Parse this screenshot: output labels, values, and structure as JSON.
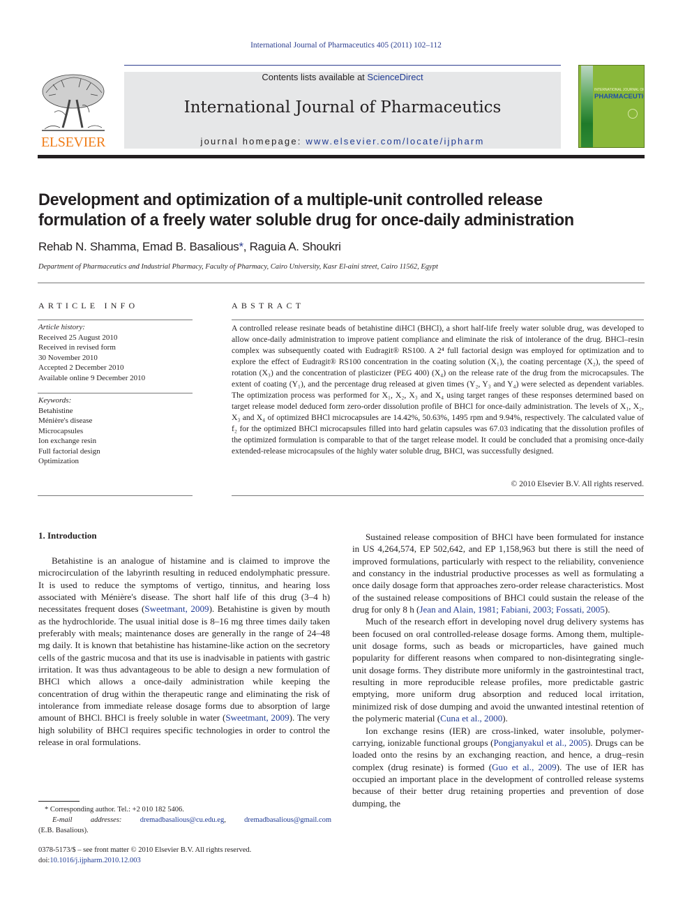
{
  "citation": "International Journal of Pharmaceutics 405 (2011) 102–112",
  "masthead": {
    "contents_prefix": "Contents lists available at ",
    "contents_link": "ScienceDirect",
    "journal_name": "International Journal of Pharmaceutics",
    "homepage_prefix": "journal homepage: ",
    "homepage_url": "www.elsevier.com/locate/ijpharm"
  },
  "publisher_logo": {
    "wordmark": "ELSEVIER",
    "color": "#f07d19"
  },
  "cover": {
    "line1": "INTERNATIONAL JOURNAL OF",
    "line2": "PHARMACEUTICS",
    "color": "#8ab83a"
  },
  "article": {
    "title": "Development and optimization of a multiple-unit controlled release formulation of a freely water soluble drug for once-daily administration",
    "authors": [
      {
        "name": "Rehab N. Shamma",
        "mark": ""
      },
      {
        "name": "Emad B. Basalious",
        "mark": "*"
      },
      {
        "name": "Raguia A. Shoukri",
        "mark": ""
      }
    ],
    "affiliation": "Department of Pharmaceutics and Industrial Pharmacy, Faculty of Pharmacy, Cairo University, Kasr El-aini street, Cairo 11562, Egypt"
  },
  "article_info": {
    "label": "ARTICLE INFO",
    "history_heading": "Article history:",
    "history": [
      "Received 25 August 2010",
      "Received in revised form",
      "30 November 2010",
      "Accepted 2 December 2010",
      "Available online 9 December 2010"
    ],
    "keywords_heading": "Keywords:",
    "keywords": [
      "Betahistine",
      "Ménière's disease",
      "Microcapsules",
      "Ion exchange resin",
      "Full factorial design",
      "Optimization"
    ]
  },
  "abstract": {
    "label": "ABSTRACT",
    "text": "A controlled release resinate beads of betahistine diHCl (BHCl), a short half-life freely water soluble drug, was developed to allow once-daily administration to improve patient compliance and eliminate the risk of intolerance of the drug. BHCl–resin complex was subsequently coated with Eudragit® RS100. A 2⁴ full factorial design was employed for optimization and to explore the effect of Eudragit® RS100 concentration in the coating solution (X₁), the coating percentage (X₂), the speed of rotation (X₃) and the concentration of plasticizer (PEG 400) (X₄) on the release rate of the drug from the microcapsules. The extent of coating (Y₁), and the percentage drug released at given times (Y₂, Y₃ and Y₄) were selected as dependent variables. The optimization process was performed for X₁, X₂, X₃ and X₄ using target ranges of these responses determined based on target release model deduced form zero-order dissolution profile of BHCl for once-daily administration. The levels of X₁, X₂, X₃ and X₄ of optimized BHCl microcapsules are 14.42%, 50.63%, 1495 rpm and 9.94%, respectively. The calculated value of f₂ for the optimized BHCl microcapsules filled into hard gelatin capsules was 67.03 indicating that the dissolution profiles of the optimized formulation is comparable to that of the target release model. It could be concluded that a promising once-daily extended-release microcapsules of the highly water soluble drug, BHCl, was successfully designed.",
    "copyright": "© 2010 Elsevier B.V. All rights reserved."
  },
  "introduction": {
    "heading": "1.  Introduction",
    "left_paragraphs": [
      [
        {
          "t": "Betahistine is an analogue of histamine and is claimed to improve the microcirculation of the labyrinth resulting in reduced endolymphatic pressure. It is used to reduce the symptoms of vertigo, tinnitus, and hearing loss associated with Ménière's disease. The short half life of this drug (3–4 h) necessitates frequent doses ("
        },
        {
          "t": "Sweetmant, 2009",
          "link": true
        },
        {
          "t": "). Betahistine is given by mouth as the hydrochloride. The usual initial dose is 8–16 mg three times daily taken preferably with meals; maintenance doses are generally in the range of 24–48 mg daily. It is known that betahistine has histamine-like action on the secretory cells of the gastric mucosa and that its use is inadvisable in patients with gastric irritation. It was thus advantageous to be able to design a new formulation of BHCl which allows a once-daily administration while keeping the concentration of drug within the therapeutic range and eliminating the risk of intolerance from immediate release dosage forms due to absorption of large amount of BHCl. BHCl is freely soluble in water ("
        },
        {
          "t": "Sweetmant, 2009",
          "link": true
        },
        {
          "t": "). The very high solubility of BHCl requires specific technologies in order to control the release in oral formulations."
        }
      ]
    ],
    "right_paragraphs": [
      [
        {
          "t": "Sustained release composition of BHCl have been formulated for instance in US 4,264,574, EP 502,642, and EP 1,158,963 but there is still the need of improved formulations, particularly with respect to the reliability, convenience and constancy in the industrial productive processes as well as formulating a once daily dosage form that approaches zero-order release characteristics. Most of the sustained release compositions of BHCl could sustain the release of the drug for only 8 h ("
        },
        {
          "t": "Jean and Alain, 1981; Fabiani, 2003; Fossati, 2005",
          "link": true
        },
        {
          "t": ")."
        }
      ],
      [
        {
          "t": "Much of the research effort in developing novel drug delivery systems has been focused on oral controlled-release dosage forms. Among them, multiple-unit dosage forms, such as beads or microparticles, have gained much popularity for different reasons when compared to non-disintegrating single-unit dosage forms. They distribute more uniformly in the gastrointestinal tract, resulting in more reproducible release profiles, more predictable gastric emptying, more uniform drug absorption and reduced local irritation, minimized risk of dose dumping and avoid the unwanted intestinal retention of the polymeric material ("
        },
        {
          "t": "Cuna et al., 2000",
          "link": true
        },
        {
          "t": ")."
        }
      ],
      [
        {
          "t": "Ion exchange resins (IER) are cross-linked, water insoluble, polymer-carrying, ionizable functional groups ("
        },
        {
          "t": "Pongjanyakul et al., 2005",
          "link": true
        },
        {
          "t": "). Drugs can be loaded onto the resins by an exchanging reaction, and hence, a drug–resin complex (drug resinate) is formed ("
        },
        {
          "t": "Guo et al., 2009",
          "link": true
        },
        {
          "t": "). The use of IER has occupied an important place in the development of controlled release systems because of their better drug retaining properties and prevention of dose dumping, the"
        }
      ]
    ]
  },
  "footnote": {
    "corresponding": "* Corresponding author. Tel.: +2 010 182 5406.",
    "email_label": "E-mail addresses:",
    "emails": [
      "dremadbasalious@cu.edu.eg",
      "dremadbasalious@gmail.com"
    ],
    "email_owner": "(E.B. Basalious).",
    "front_matter": "0378-5173/$ – see front matter © 2010 Elsevier B.V. All rights reserved.",
    "doi_prefix": "doi:",
    "doi": "10.1016/j.ijpharm.2010.12.003"
  }
}
